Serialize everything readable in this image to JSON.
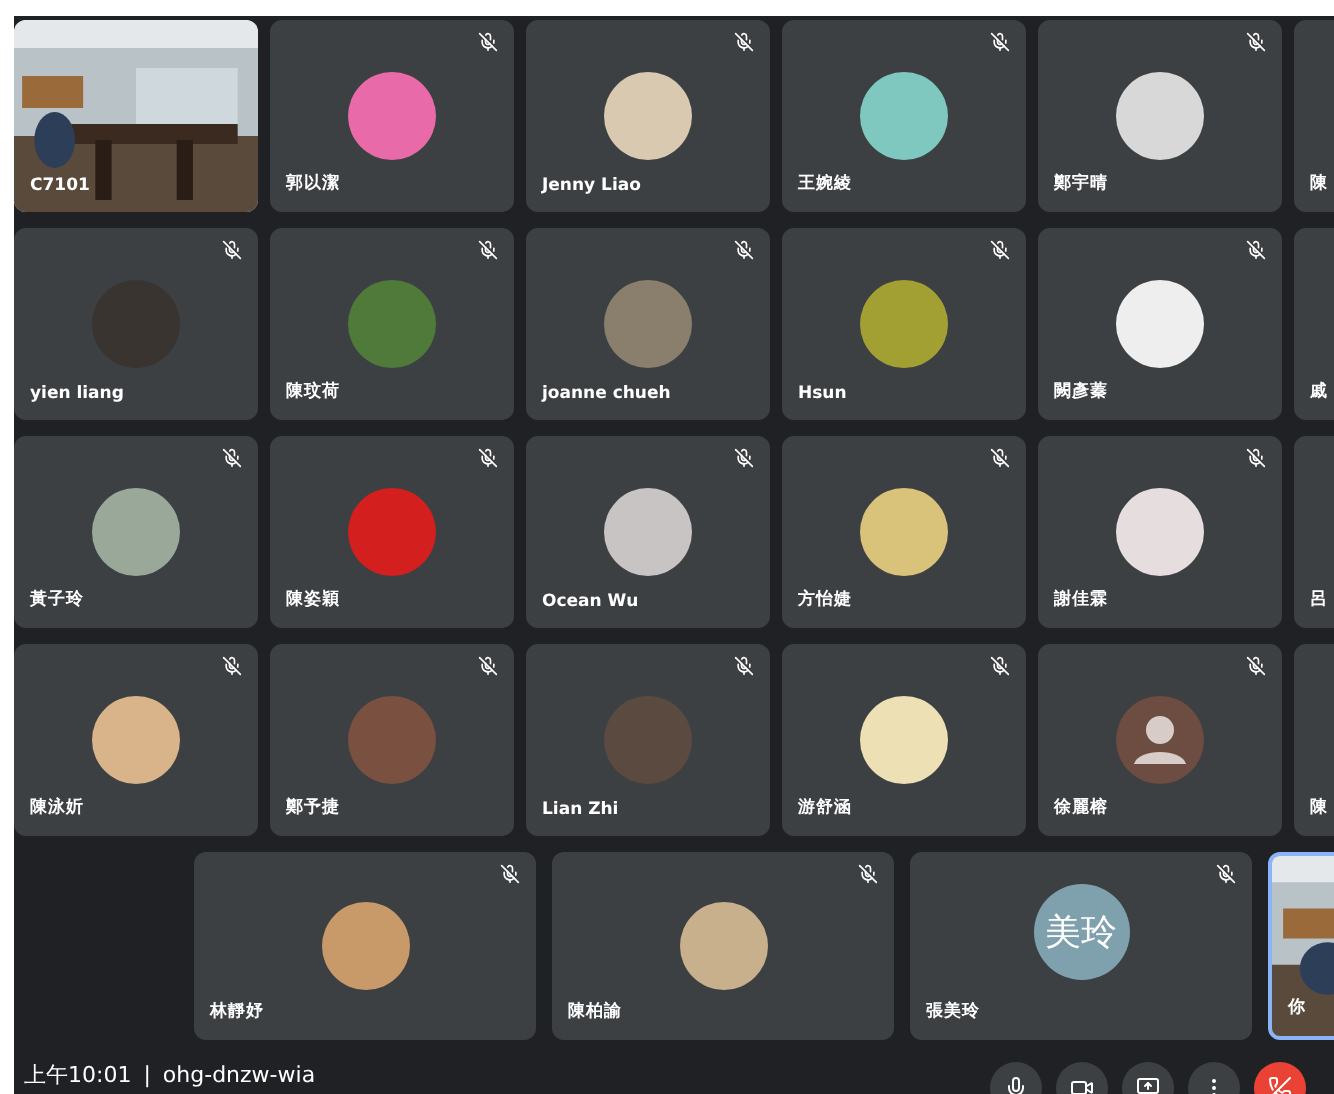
{
  "grid": [
    {
      "name": "C7101",
      "kind": "camera",
      "muted": false
    },
    {
      "name": "郭以潔",
      "kind": "avatar",
      "color": "#e86aa8",
      "muted": true
    },
    {
      "name": "Jenny Liao",
      "kind": "avatar",
      "color": "#d9c9b0",
      "muted": true
    },
    {
      "name": "王婉綾",
      "kind": "avatar",
      "color": "#7fc8c0",
      "muted": true
    },
    {
      "name": "鄭宇晴",
      "kind": "avatar",
      "color": "#d8d8d8",
      "muted": true
    },
    {
      "name": "陳",
      "kind": "cut"
    },
    {
      "name": "yien liang",
      "kind": "avatar",
      "color": "#3a3430",
      "muted": true
    },
    {
      "name": "陳玟荷",
      "kind": "avatar",
      "color": "#4f7a3a",
      "muted": true
    },
    {
      "name": "joanne chueh",
      "kind": "avatar",
      "color": "#8a7f6c",
      "muted": true
    },
    {
      "name": "Hsun",
      "kind": "avatar",
      "color": "#a3a033",
      "muted": true
    },
    {
      "name": "闕彥蓁",
      "kind": "avatar",
      "color": "#eeeeee",
      "muted": true
    },
    {
      "name": "戚",
      "kind": "cut"
    },
    {
      "name": "黃子玲",
      "kind": "avatar",
      "color": "#9aa89a",
      "muted": true
    },
    {
      "name": "陳姿穎",
      "kind": "avatar",
      "color": "#d41f1f",
      "muted": true
    },
    {
      "name": "Ocean Wu",
      "kind": "avatar",
      "color": "#c9c4c4",
      "muted": true
    },
    {
      "name": "方怡婕",
      "kind": "avatar",
      "color": "#d9c27a",
      "muted": true
    },
    {
      "name": "謝佳霖",
      "kind": "avatar",
      "color": "#e6dede",
      "muted": true
    },
    {
      "name": "呂",
      "kind": "cut"
    },
    {
      "name": "陳泳妡",
      "kind": "avatar",
      "color": "#d9b48a",
      "muted": true
    },
    {
      "name": "鄭予捷",
      "kind": "avatar",
      "color": "#7a5040",
      "muted": true
    },
    {
      "name": "Lian Zhi",
      "kind": "avatar",
      "color": "#5a4a40",
      "muted": true
    },
    {
      "name": "游舒涵",
      "kind": "avatar",
      "color": "#ece0b4",
      "muted": true
    },
    {
      "name": "徐麗榕",
      "kind": "silhouette",
      "muted": true
    },
    {
      "name": "陳",
      "kind": "cut"
    }
  ],
  "bottom_row": [
    {
      "name": "林靜妤",
      "kind": "avatar",
      "color": "#c89a6a",
      "muted": true
    },
    {
      "name": "陳柏諭",
      "kind": "avatar",
      "color": "#c8b08c",
      "muted": true
    },
    {
      "name": "張美玲",
      "kind": "initials",
      "initials": "美玲",
      "muted": true
    },
    {
      "name": "你",
      "kind": "camera",
      "selected": true
    }
  ],
  "status_bar": {
    "time": "上午10:01",
    "separator": "|",
    "meeting_code": "ohg-dnzw-wia"
  }
}
